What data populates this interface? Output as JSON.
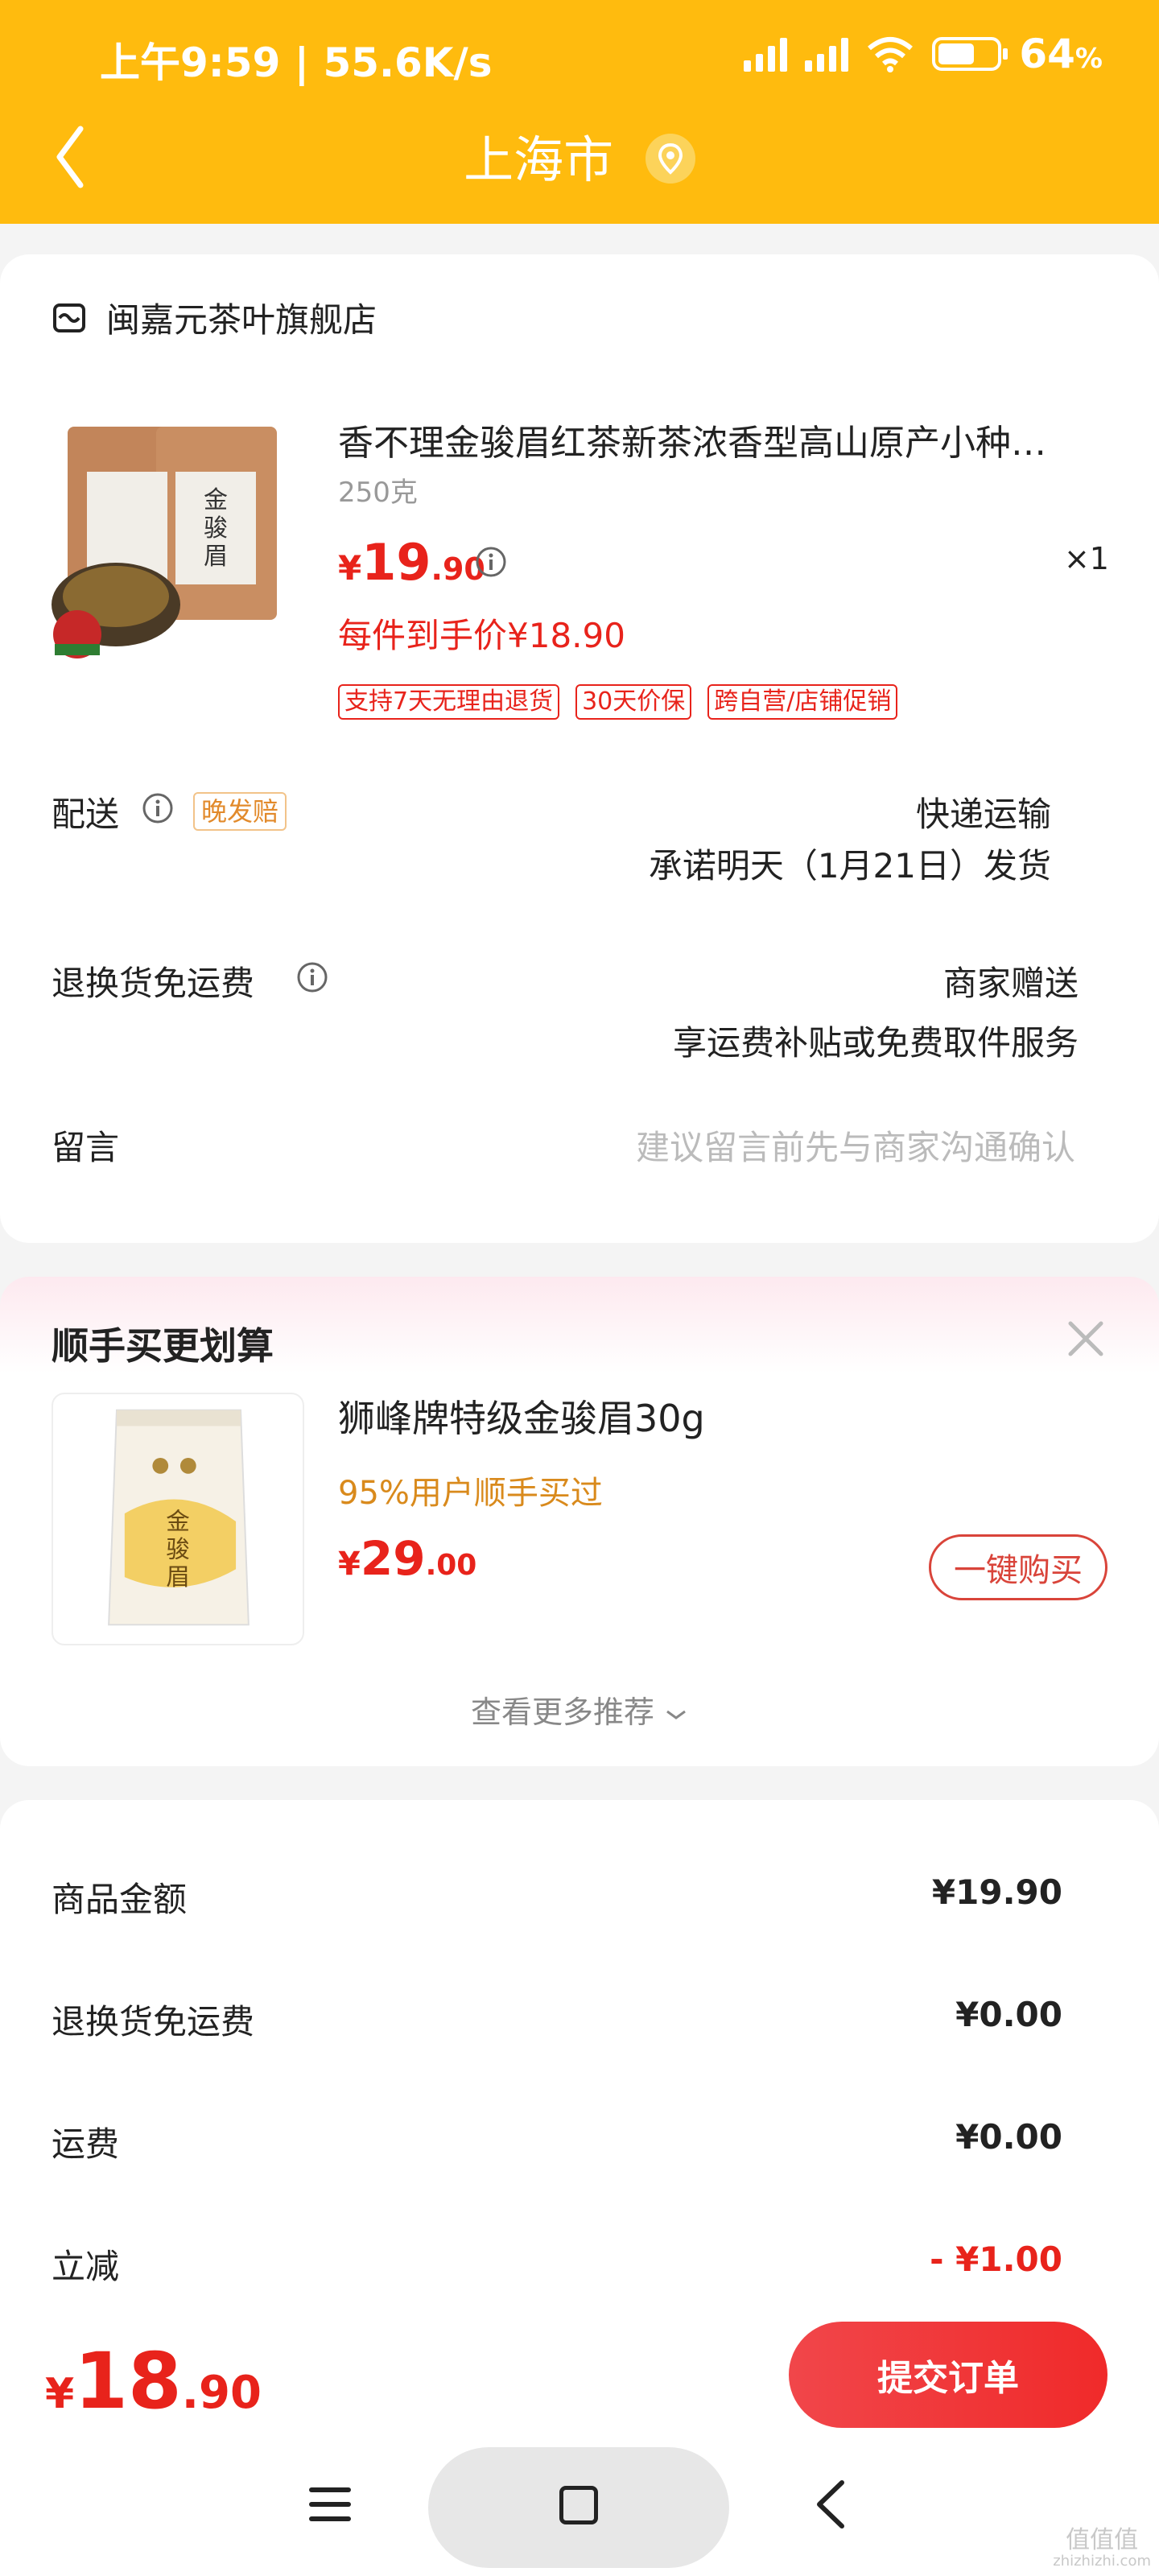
{
  "status_bar": {
    "time_speed": "上午9:59 | 55.6K/s",
    "battery": "64",
    "battery_unit": "%"
  },
  "header": {
    "title": "上海市"
  },
  "order": {
    "shop_name": "闽嘉元茶叶旗舰店",
    "product": {
      "title": "香不理金骏眉红茶新茶浓香型高山原产小种…",
      "spec": "250克",
      "price_symbol": "¥",
      "price_int": "19",
      "price_dec": ".90",
      "quantity": "×1",
      "final_price": "每件到手价¥18.90",
      "tags": [
        "支持7天无理由退货",
        "30天价保",
        "跨自营/店铺促销"
      ]
    },
    "delivery": {
      "label": "配送",
      "tag": "晚发赔",
      "method": "快递运输",
      "promise": "承诺明天（1月21日）发货"
    },
    "return_shipping": {
      "label": "退换货免运费",
      "value": "商家赠送",
      "desc": "享运费补贴或免费取件服务"
    },
    "message": {
      "label": "留言",
      "placeholder": "建议留言前先与商家沟通确认"
    }
  },
  "recommend": {
    "title": "顺手买更划算",
    "item_name": "狮峰牌特级金骏眉30g",
    "item_sub": "95%用户顺手买过",
    "price_symbol": "¥",
    "price_int": "29",
    "price_dec": ".00",
    "buy_label": "一键购买",
    "more_label": "查看更多推荐"
  },
  "summary": {
    "rows": [
      {
        "label": "商品金额",
        "value": "¥19.90"
      },
      {
        "label": "退换货免运费",
        "value": "¥0.00"
      },
      {
        "label": "运费",
        "value": "¥0.00"
      },
      {
        "label": "立减",
        "value": "- ¥1.00"
      }
    ]
  },
  "footer": {
    "total_symbol": "¥",
    "total_int": "18",
    "total_dec": ".90",
    "submit_label": "提交订单"
  },
  "watermark": {
    "title": "值值值",
    "url": "zhizhizhi.com"
  },
  "colors": {
    "brand_yellow": "#ffbb0e",
    "price_red": "#e8231b",
    "accent_orange": "#d98a1c"
  }
}
